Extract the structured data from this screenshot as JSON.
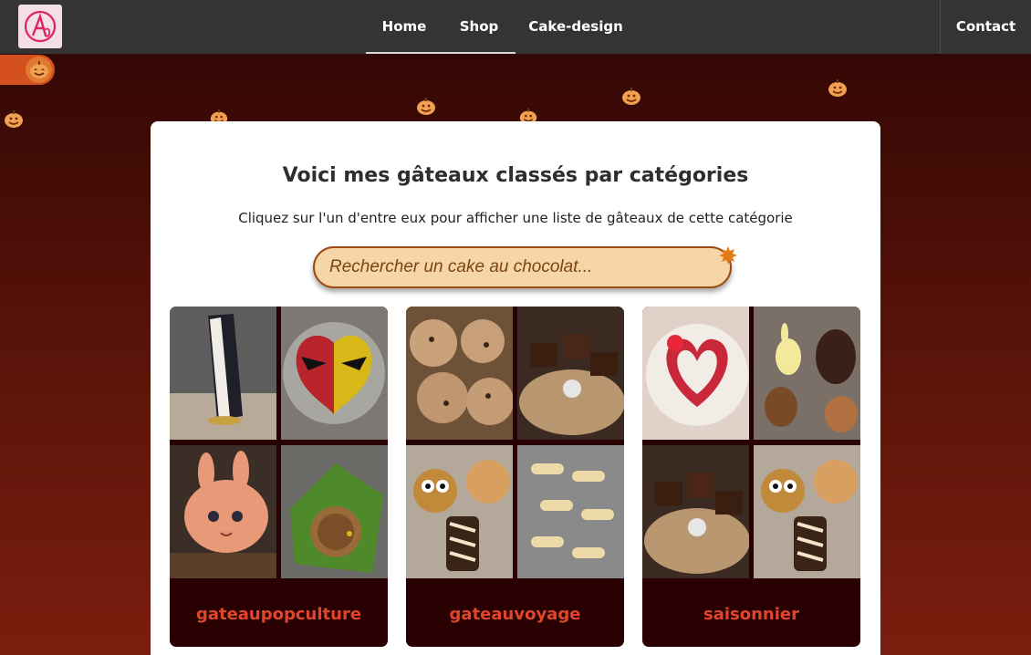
{
  "nav": {
    "logo_text": "A",
    "links": [
      "Home",
      "Shop",
      "Cake-design"
    ],
    "contact": "Contact"
  },
  "theme": {
    "toggle_icon": "pumpkin-icon",
    "accent": "#e0472a"
  },
  "main": {
    "title": "Voici mes gâteaux classés par catégories",
    "subtitle": "Cliquez sur l'un d'entre eux pour afficher une liste de gâteaux de cette catégorie",
    "search_placeholder": "Rechercher un cake au chocolat..."
  },
  "categories": [
    {
      "label": "gateaupopculture",
      "images": [
        "tall-cake",
        "heart-mask-cake",
        "bunny-face-cake",
        "hobbit-door-cake"
      ]
    },
    {
      "label": "gateauvoyage",
      "images": [
        "cookies",
        "chocolate-bites",
        "monster-treats",
        "bone-cookies"
      ]
    },
    {
      "label": "saisonnier",
      "images": [
        "heart-tart",
        "chocolate-bunnies",
        "chocolate-bites",
        "monster-treats"
      ]
    }
  ]
}
